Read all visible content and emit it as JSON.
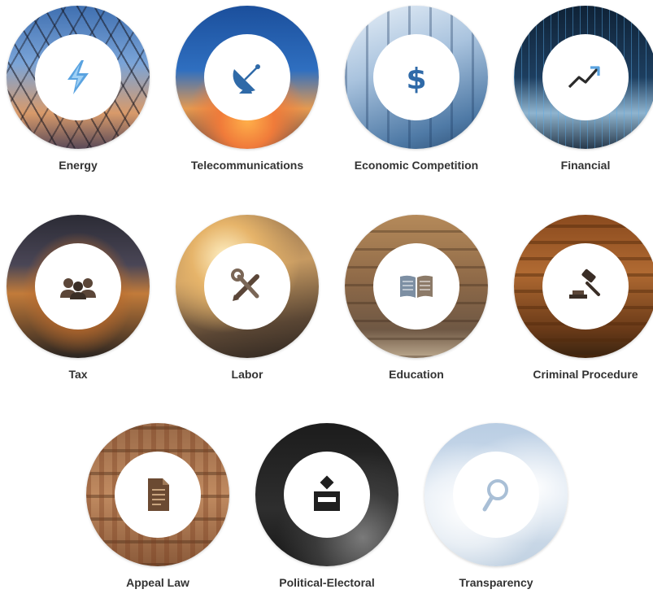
{
  "categories": [
    {
      "label": "Energy",
      "icon": "lightning-bolt-icon"
    },
    {
      "label": "Telecommunications",
      "icon": "satellite-dish-icon"
    },
    {
      "label": "Economic Competition",
      "icon": "dollar-sign-icon"
    },
    {
      "label": "Financial",
      "icon": "trend-up-arrow-icon"
    },
    {
      "label": "Tax",
      "icon": "people-group-icon"
    },
    {
      "label": "Labor",
      "icon": "wrench-pencil-icon"
    },
    {
      "label": "Education",
      "icon": "open-book-icon"
    },
    {
      "label": "Criminal Procedure",
      "icon": "gavel-icon"
    },
    {
      "label": "Appeal Law",
      "icon": "document-icon"
    },
    {
      "label": "Political-Electoral",
      "icon": "ballot-box-icon"
    },
    {
      "label": "Transparency",
      "icon": "magnifier-icon"
    }
  ],
  "colors": {
    "label_text": "#333333",
    "icon_blue": "#5aa3e0",
    "icon_dark_blue": "#2f6aa8",
    "icon_dark": "#2a2a2a",
    "icon_brown": "#5b4638",
    "icon_transparency": "#a9bfd6"
  }
}
